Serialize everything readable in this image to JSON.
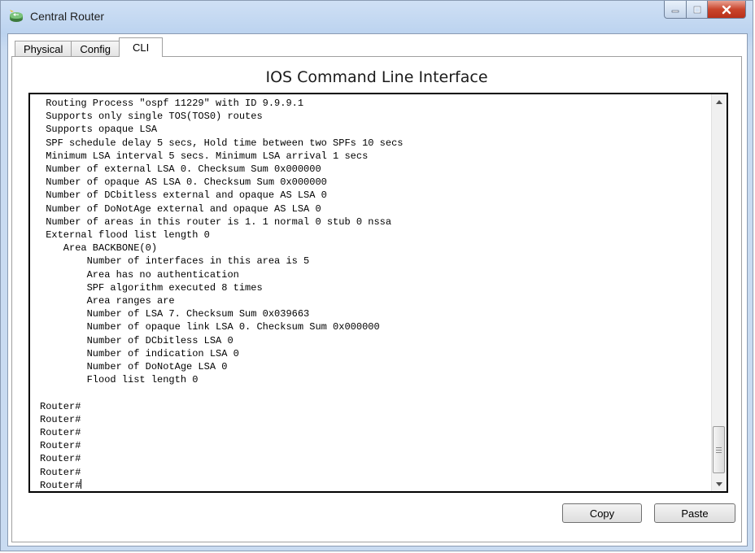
{
  "window": {
    "title": "Central Router"
  },
  "tabs": [
    {
      "label": "Physical",
      "active": false
    },
    {
      "label": "Config",
      "active": false
    },
    {
      "label": "CLI",
      "active": true
    }
  ],
  "cli": {
    "heading": "IOS Command Line Interface",
    "output": " Routing Process \"ospf 11229\" with ID 9.9.9.1\n Supports only single TOS(TOS0) routes\n Supports opaque LSA\n SPF schedule delay 5 secs, Hold time between two SPFs 10 secs\n Minimum LSA interval 5 secs. Minimum LSA arrival 1 secs\n Number of external LSA 0. Checksum Sum 0x000000\n Number of opaque AS LSA 0. Checksum Sum 0x000000\n Number of DCbitless external and opaque AS LSA 0\n Number of DoNotAge external and opaque AS LSA 0\n Number of areas in this router is 1. 1 normal 0 stub 0 nssa\n External flood list length 0\n    Area BACKBONE(0)\n        Number of interfaces in this area is 5\n        Area has no authentication\n        SPF algorithm executed 8 times\n        Area ranges are\n        Number of LSA 7. Checksum Sum 0x039663\n        Number of opaque link LSA 0. Checksum Sum 0x000000\n        Number of DCbitless LSA 0\n        Number of indication LSA 0\n        Number of DoNotAge LSA 0\n        Flood list length 0\n\nRouter#\nRouter#\nRouter#\nRouter#\nRouter#\nRouter#\nRouter#",
    "copy_label": "Copy",
    "paste_label": "Paste"
  },
  "icons": {
    "app": "router-icon",
    "minimize": "minimize-icon",
    "maximize": "maximize-icon",
    "close": "close-icon",
    "scroll_up": "scroll-up-arrow-icon",
    "scroll_down": "scroll-down-arrow-icon",
    "grip": "grip-icon"
  },
  "colors": {
    "close_button": "#c9452c",
    "title_bar": "#bcd3ef",
    "console_border": "#000000"
  },
  "scroll": {
    "position": "bottom"
  }
}
